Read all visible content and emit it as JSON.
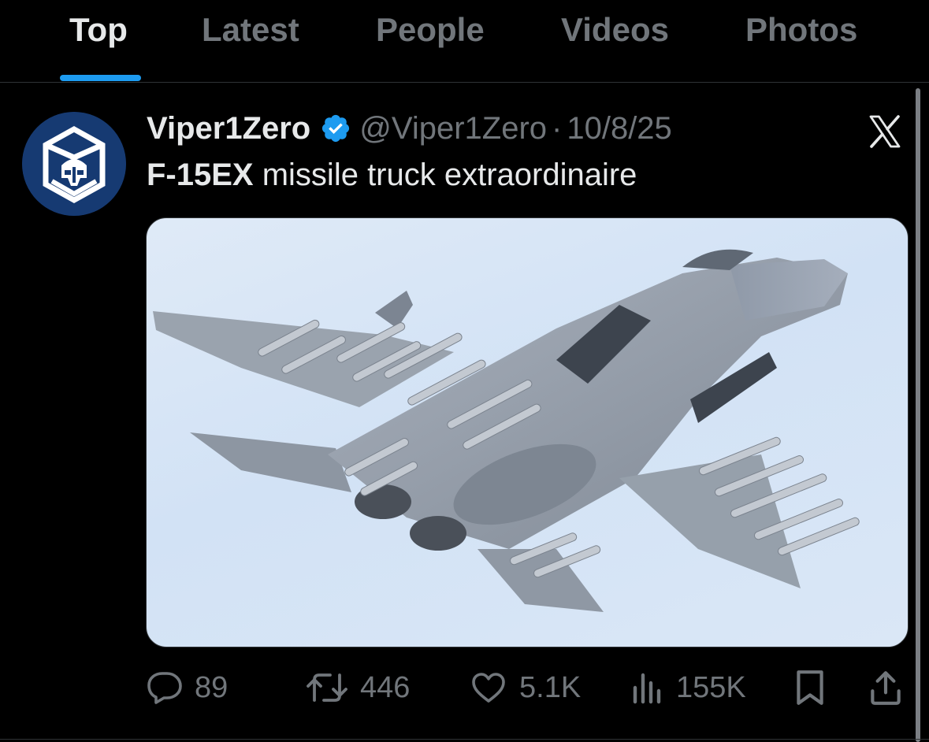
{
  "tabs": [
    {
      "label": "Top",
      "active": true
    },
    {
      "label": "Latest",
      "active": false
    },
    {
      "label": "People",
      "active": false
    },
    {
      "label": "Videos",
      "active": false
    },
    {
      "label": "Photos",
      "active": false
    }
  ],
  "tweet": {
    "display_name": "Viper1Zero",
    "verified": true,
    "handle": "@Viper1Zero",
    "separator": "·",
    "date": "10/8/25",
    "text_bold": "F-15EX",
    "text_rest": " missile truck extraordinaire",
    "media": {
      "icon": "fighter-jet-photo"
    },
    "actions": {
      "replies": "89",
      "reposts": "446",
      "likes": "5.1K",
      "views": "155K"
    }
  },
  "icons": {
    "verified": "verified-badge-icon",
    "platform": "x-logo-icon",
    "reply": "reply-icon",
    "repost": "repost-icon",
    "like": "heart-icon",
    "views": "views-icon",
    "bookmark": "bookmark-icon",
    "share": "share-icon"
  },
  "colors": {
    "accent": "#1d9bf0",
    "muted": "#71767b",
    "text": "#e7e9ea",
    "background": "#000000"
  }
}
